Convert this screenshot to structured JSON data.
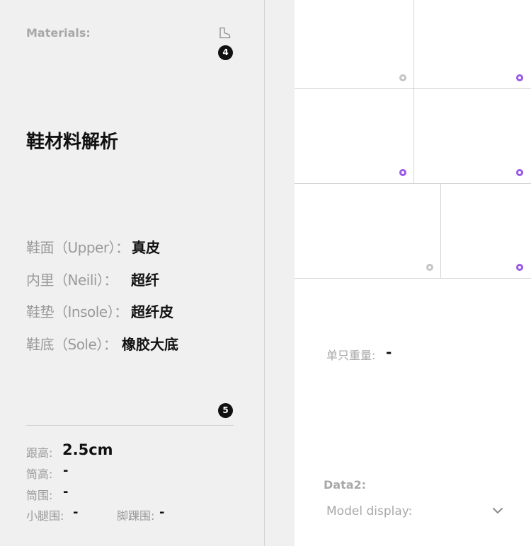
{
  "left_panel": {
    "materials_label": "Materials:",
    "badge_top": "4",
    "title": "鞋材料解析",
    "materials": [
      {
        "label": "鞋面（Upper）：",
        "value": "真皮"
      },
      {
        "label": "内里（Neili）：",
        "value": "超纤"
      },
      {
        "label": "鞋垫（Insole）：",
        "value": "超纤皮"
      },
      {
        "label": "鞋底（Sole）：",
        "value": "橡胶大底"
      }
    ],
    "badge_bottom": "5",
    "specs": {
      "heel_height_label": "跟高:",
      "heel_height_value": "2.5cm",
      "shaft_height_label": "筒高:",
      "shaft_height_value": "-",
      "shaft_circ_label": "筒围:",
      "shaft_circ_value": "-",
      "calf_circ_label": "小腿围:",
      "calf_circ_value": "-",
      "ankle_circ_label": "脚踝围:",
      "ankle_circ_value": "-"
    }
  },
  "right_panel": {
    "weight_label": "单只重量:",
    "weight_value": "-",
    "data2_label": "Data2:",
    "model_display_label": "Model display:"
  },
  "colors": {
    "accent_purple": "#9b57e6",
    "inactive_gray": "#c4c4c4",
    "panel_bg": "#f0f0f0"
  },
  "icons": [
    "shoe-icon",
    "chevron-down-icon",
    "radio-dot-icon"
  ]
}
